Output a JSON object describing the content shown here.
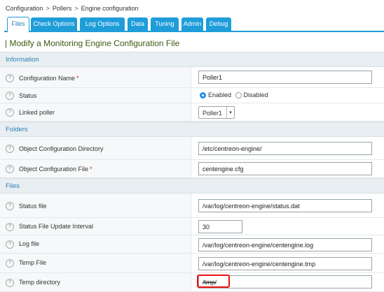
{
  "breadcrumb": [
    "Configuration",
    "Pollers",
    "Engine configuration"
  ],
  "tabs": [
    "Files",
    "Check Options",
    "Log Options",
    "Data",
    "Tuning",
    "Admin",
    "Debug"
  ],
  "active_tab": "Files",
  "page_title": "| Modify a Monitoring Engine Configuration File",
  "sections": {
    "information": "Information",
    "folders": "Folders",
    "files": "Files"
  },
  "fields": {
    "config_name": {
      "label": "Configuration Name",
      "value": "Poller1",
      "required": true
    },
    "status": {
      "label": "Status",
      "options": [
        "Enabled",
        "Disabled"
      ],
      "selected": "Enabled"
    },
    "linked_poller": {
      "label": "Linked poller",
      "value": "Poller1"
    },
    "object_config_dir": {
      "label": "Object Configuration Directory",
      "value": "/etc/centreon-engine/"
    },
    "object_config_file": {
      "label": "Object Configuration File",
      "value": "centengine.cfg",
      "required": true
    },
    "status_file": {
      "label": "Status file",
      "value": "/var/log/centreon-engine/status.dat"
    },
    "status_file_interval": {
      "label": "Status File Update Interval",
      "value": "30"
    },
    "log_file": {
      "label": "Log file",
      "value": "/var/log/centreon-engine/centengine.log"
    },
    "temp_file": {
      "label": "Temp File",
      "value": "/var/log/centreon-engine/centengine.tmp"
    },
    "temp_dir": {
      "label": "Temp directory",
      "value": "/tmp/"
    }
  },
  "help_glyph": "?",
  "required_mark": "*",
  "select_arrow": "▾",
  "colors": {
    "accent": "#1f9dd9",
    "title": "#3a5a10",
    "highlight": "#e11111"
  }
}
